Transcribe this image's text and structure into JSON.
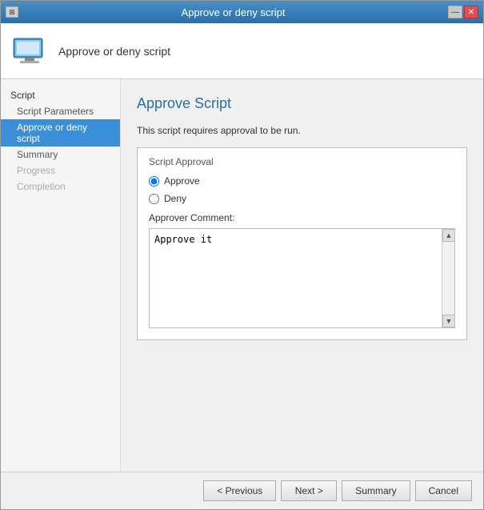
{
  "window": {
    "title": "Approve or deny script",
    "close_label": "✕",
    "minimize_label": "—"
  },
  "header": {
    "title": "Approve or deny script"
  },
  "sidebar": {
    "section": "Script",
    "items": [
      {
        "label": "Script Parameters",
        "state": "normal"
      },
      {
        "label": "Approve or deny script",
        "state": "active"
      },
      {
        "label": "Summary",
        "state": "normal"
      },
      {
        "label": "Progress",
        "state": "disabled"
      },
      {
        "label": "Completion",
        "state": "disabled"
      }
    ]
  },
  "content": {
    "title": "Approve Script",
    "description": "This script requires approval to be run.",
    "group_label": "Script Approval",
    "radio_approve": "Approve",
    "radio_deny": "Deny",
    "approver_comment_label": "Approver Comment:",
    "approver_comment_value": "Approve it"
  },
  "footer": {
    "previous_label": "< Previous",
    "next_label": "Next >",
    "summary_label": "Summary",
    "cancel_label": "Cancel"
  }
}
